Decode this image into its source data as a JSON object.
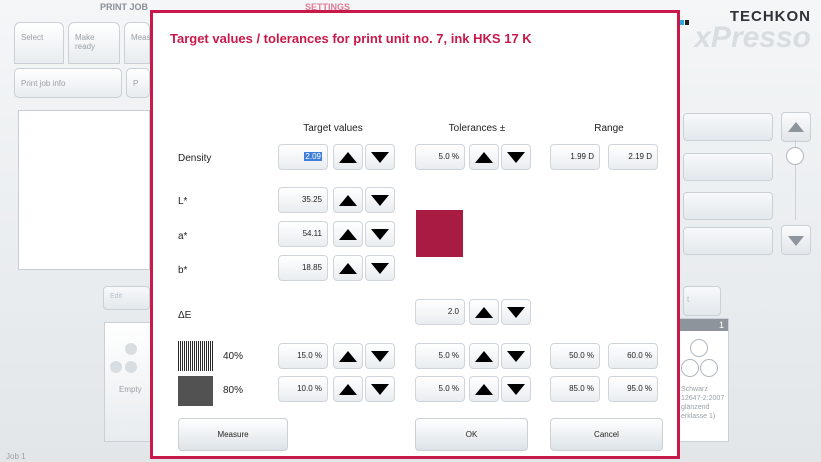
{
  "background": {
    "sections": {
      "print_job": "PRINT JOB",
      "settings": "SETTINGS"
    },
    "tabs": [
      "Select",
      "Make ready",
      "Meas"
    ],
    "subtabs": [
      "Print job info",
      "P"
    ],
    "edit_button": "Edit",
    "right_button_fragment": "t",
    "empty_label": "Empty",
    "card_number": "1",
    "card_text": [
      "Schwarz",
      "12647-2:2007",
      "glänzend",
      "erklasse 1)"
    ],
    "footer_left": "Job 1",
    "brand": "TECHKON",
    "product": "xPresso"
  },
  "dialog": {
    "title": "Target values / tolerances for print unit no. 7, ink HKS 17 K",
    "columns": {
      "target": "Target values",
      "tolerances": "Tolerances ±",
      "range": "Range"
    },
    "density": {
      "label": "Density",
      "target": "2.09",
      "tolerance": "5.0 %",
      "range_min": "1.99 D",
      "range_max": "2.19 D"
    },
    "lab": [
      {
        "label": "L*",
        "value": "35.25"
      },
      {
        "label": "a*",
        "value": "54.11"
      },
      {
        "label": "b*",
        "value": "18.85"
      }
    ],
    "swatch_color": "#a81c43",
    "delta_e": {
      "label": "ΔE",
      "tolerance": "2.0"
    },
    "screens": [
      {
        "label": "40%",
        "target": "15.0 %",
        "tolerance": "5.0 %",
        "range_min": "50.0 %",
        "range_max": "60.0 %"
      },
      {
        "label": "80%",
        "target": "10.0 %",
        "tolerance": "5.0 %",
        "range_min": "85.0 %",
        "range_max": "95.0 %"
      }
    ],
    "buttons": {
      "measure": "Measure",
      "ok": "OK",
      "cancel": "Cancel"
    },
    "accent_color": "#c8194a"
  }
}
